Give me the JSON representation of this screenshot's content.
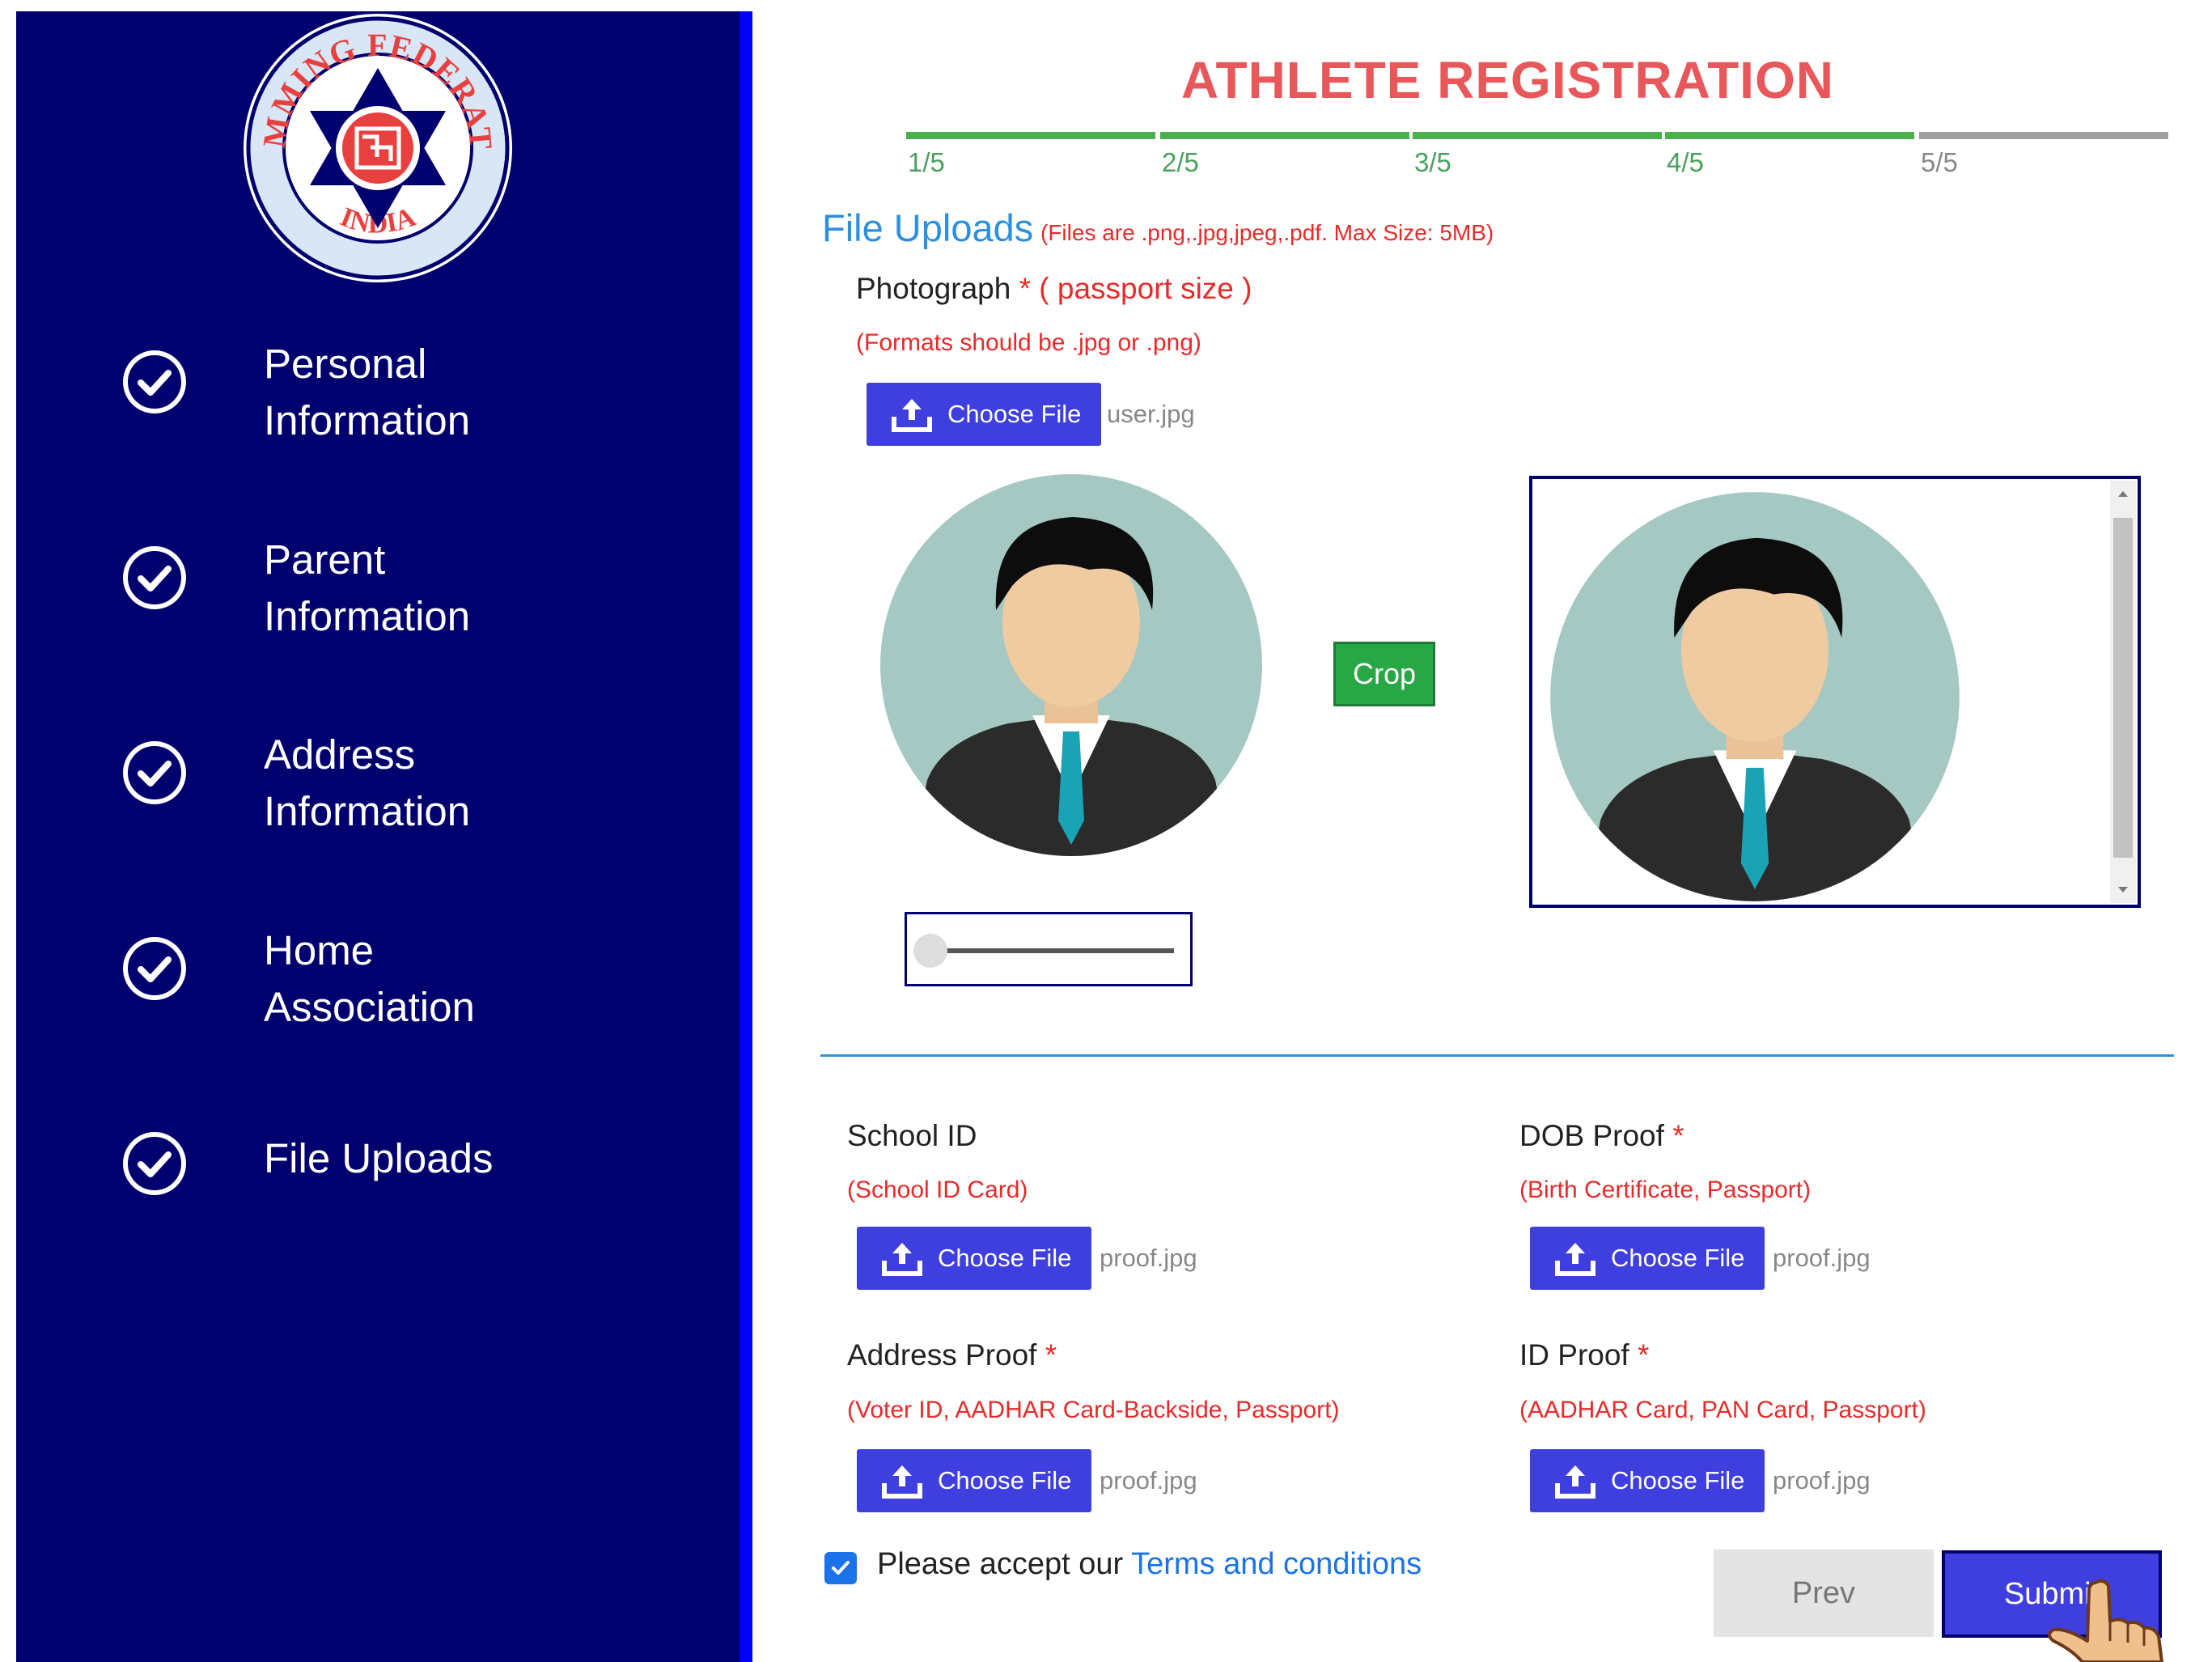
{
  "sidebar": {
    "logo": {
      "top_text": "SWIMMING FEDERATION",
      "bottom_text": "INDIA",
      "icon": "federation-star-emblem"
    },
    "items": [
      {
        "label_line1": "Personal",
        "label_line2": "Information",
        "icon": "check-circle-icon"
      },
      {
        "label_line1": "Parent",
        "label_line2": "Information",
        "icon": "check-circle-icon"
      },
      {
        "label_line1": "Address",
        "label_line2": "Information",
        "icon": "check-circle-icon"
      },
      {
        "label_line1": "Home",
        "label_line2": "Association",
        "icon": "check-circle-icon"
      },
      {
        "label_line1": "File Uploads",
        "label_line2": "",
        "icon": "check-circle-icon"
      }
    ]
  },
  "header": {
    "title": "ATHLETE REGISTRATION"
  },
  "progress": {
    "steps": [
      "1/5",
      "2/5",
      "3/5",
      "4/5",
      "5/5"
    ],
    "completed": 4,
    "total": 5
  },
  "section": {
    "title": "File Uploads",
    "note": "(Files are .png,.jpg,jpeg,.pdf. Max Size: 5MB)"
  },
  "photograph": {
    "label": "Photograph",
    "required": "*",
    "size_hint": "( passport size )",
    "format_hint": "(Formats should be .jpg or .png)",
    "button_label": "Choose File",
    "file_name": "user.jpg",
    "crop_label": "Crop",
    "zoom_level": 0
  },
  "uploads": {
    "school_id": {
      "label": "School ID",
      "required": "",
      "hint": "(School ID Card)",
      "button_label": "Choose File",
      "file_name": "proof.jpg"
    },
    "dob_proof": {
      "label": "DOB Proof",
      "required": "*",
      "hint": "(Birth Certificate, Passport)",
      "button_label": "Choose File",
      "file_name": "proof.jpg"
    },
    "address_proof": {
      "label": "Address Proof",
      "required": "*",
      "hint": "(Voter ID, AADHAR Card-Backside, Passport)",
      "button_label": "Choose File",
      "file_name": "proof.jpg"
    },
    "id_proof": {
      "label": "ID Proof",
      "required": "*",
      "hint": "(AADHAR Card, PAN Card, Passport)",
      "button_label": "Choose File",
      "file_name": "proof.jpg"
    }
  },
  "terms": {
    "checked": true,
    "text": "Please accept our",
    "link": "Terms and conditions"
  },
  "actions": {
    "prev_label": "Prev",
    "submit_label": "Submit"
  },
  "colors": {
    "sidebar_bg": "#00006e",
    "accent_blue": "#3f3fe0",
    "title_red": "#e8575a",
    "progress_green": "#4caf50",
    "progress_gray": "#9e9e9e",
    "crop_green": "#28a745"
  }
}
